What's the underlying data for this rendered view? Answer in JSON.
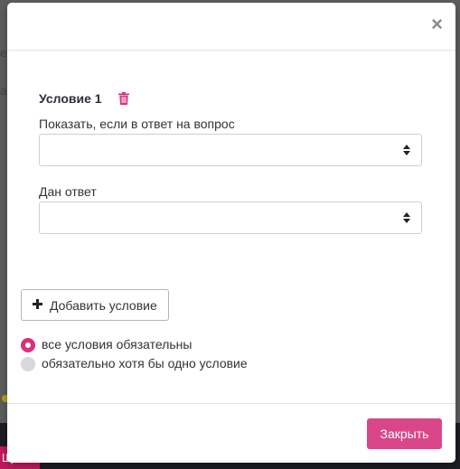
{
  "modal": {
    "close_icon": "close-icon",
    "condition": {
      "title": "Условие 1",
      "delete_icon": "trash-icon",
      "question_label": "Показать, если в ответ на вопрос",
      "question_value": "",
      "answer_label": "Дан ответ",
      "answer_value": ""
    },
    "add_condition_label": "Добавить условие",
    "logic_options": [
      {
        "label": "все условия обязательны",
        "selected": true
      },
      {
        "label": "обязательно хотя бы одно условие",
        "selected": false
      }
    ],
    "close_button_label": "Закрыть"
  },
  "background": {
    "pink_tab_text": "Щ"
  },
  "colors": {
    "accent": "#d9478a",
    "radio_active": "#d9327c",
    "trash_icon": "#d9327c"
  }
}
